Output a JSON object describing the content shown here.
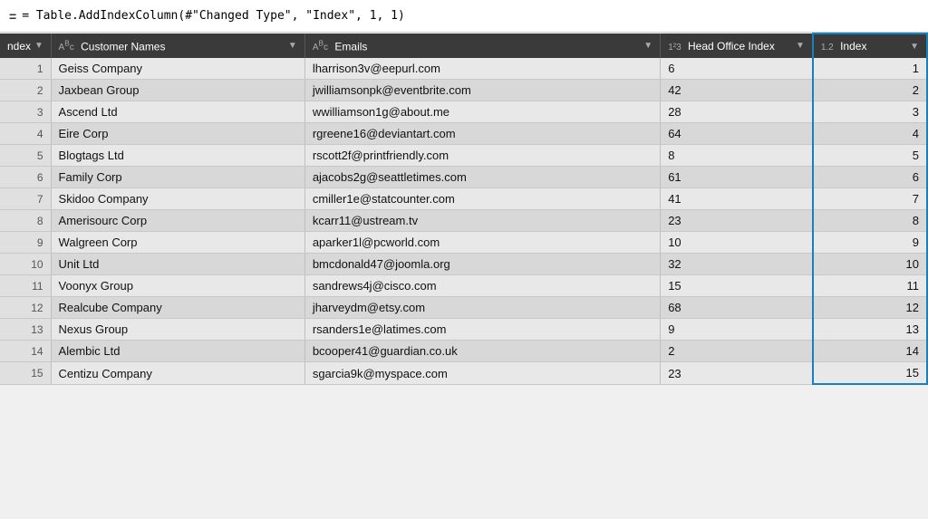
{
  "formula": "= Table.AddIndexColumn(#\"Changed Type\", \"Index\", 1, 1)",
  "columns": [
    {
      "id": "row-num",
      "type": "",
      "label": "ndex",
      "icon": "filter"
    },
    {
      "id": "names",
      "type": "ABc",
      "label": "Customer Names",
      "icon": "filter"
    },
    {
      "id": "emails",
      "type": "ABc",
      "label": "Emails",
      "icon": "filter"
    },
    {
      "id": "hoidx",
      "type": "1²3",
      "label": "Head Office Index",
      "icon": "filter"
    },
    {
      "id": "index",
      "type": "1.2",
      "label": "Index",
      "icon": "filter"
    }
  ],
  "rows": [
    {
      "num": 1,
      "name": "Geiss Company",
      "email": "lharrison3v@eepurl.com",
      "hoi": "6",
      "idx": 1
    },
    {
      "num": 2,
      "name": "Jaxbean Group",
      "email": "jwilliamsonpk@eventbrite.com",
      "hoi": "42",
      "idx": 2
    },
    {
      "num": 3,
      "name": "Ascend Ltd",
      "email": "wwilliamson1g@about.me",
      "hoi": "28",
      "idx": 3
    },
    {
      "num": 4,
      "name": "Eire Corp",
      "email": "rgreene16@deviantart.com",
      "hoi": "64",
      "idx": 4
    },
    {
      "num": 5,
      "name": "Blogtags Ltd",
      "email": "rscott2f@printfriendly.com",
      "hoi": "8",
      "idx": 5
    },
    {
      "num": 6,
      "name": "Family Corp",
      "email": "ajacobs2g@seattletimes.com",
      "hoi": "61",
      "idx": 6
    },
    {
      "num": 7,
      "name": "Skidoo Company",
      "email": "cmiller1e@statcounter.com",
      "hoi": "41",
      "idx": 7
    },
    {
      "num": 8,
      "name": "Amerisourc Corp",
      "email": "kcarr11@ustream.tv",
      "hoi": "23",
      "idx": 8
    },
    {
      "num": 9,
      "name": "Walgreen Corp",
      "email": "aparker1l@pcworld.com",
      "hoi": "10",
      "idx": 9
    },
    {
      "num": 10,
      "name": "Unit Ltd",
      "email": "bmcdonald47@joomla.org",
      "hoi": "32",
      "idx": 10
    },
    {
      "num": 11,
      "name": "Voonyx Group",
      "email": "sandrews4j@cisco.com",
      "hoi": "15",
      "idx": 11
    },
    {
      "num": 12,
      "name": "Realcube Company",
      "email": "jharveydm@etsy.com",
      "hoi": "68",
      "idx": 12
    },
    {
      "num": 13,
      "name": "Nexus Group",
      "email": "rsanders1e@latimes.com",
      "hoi": "9",
      "idx": 13
    },
    {
      "num": 14,
      "name": "Alembic Ltd",
      "email": "bcooper41@guardian.co.uk",
      "hoi": "2",
      "idx": 14
    },
    {
      "num": 15,
      "name": "Centizu Company",
      "email": "sgarcia9k@myspace.com",
      "hoi": "23",
      "idx": 15
    }
  ]
}
